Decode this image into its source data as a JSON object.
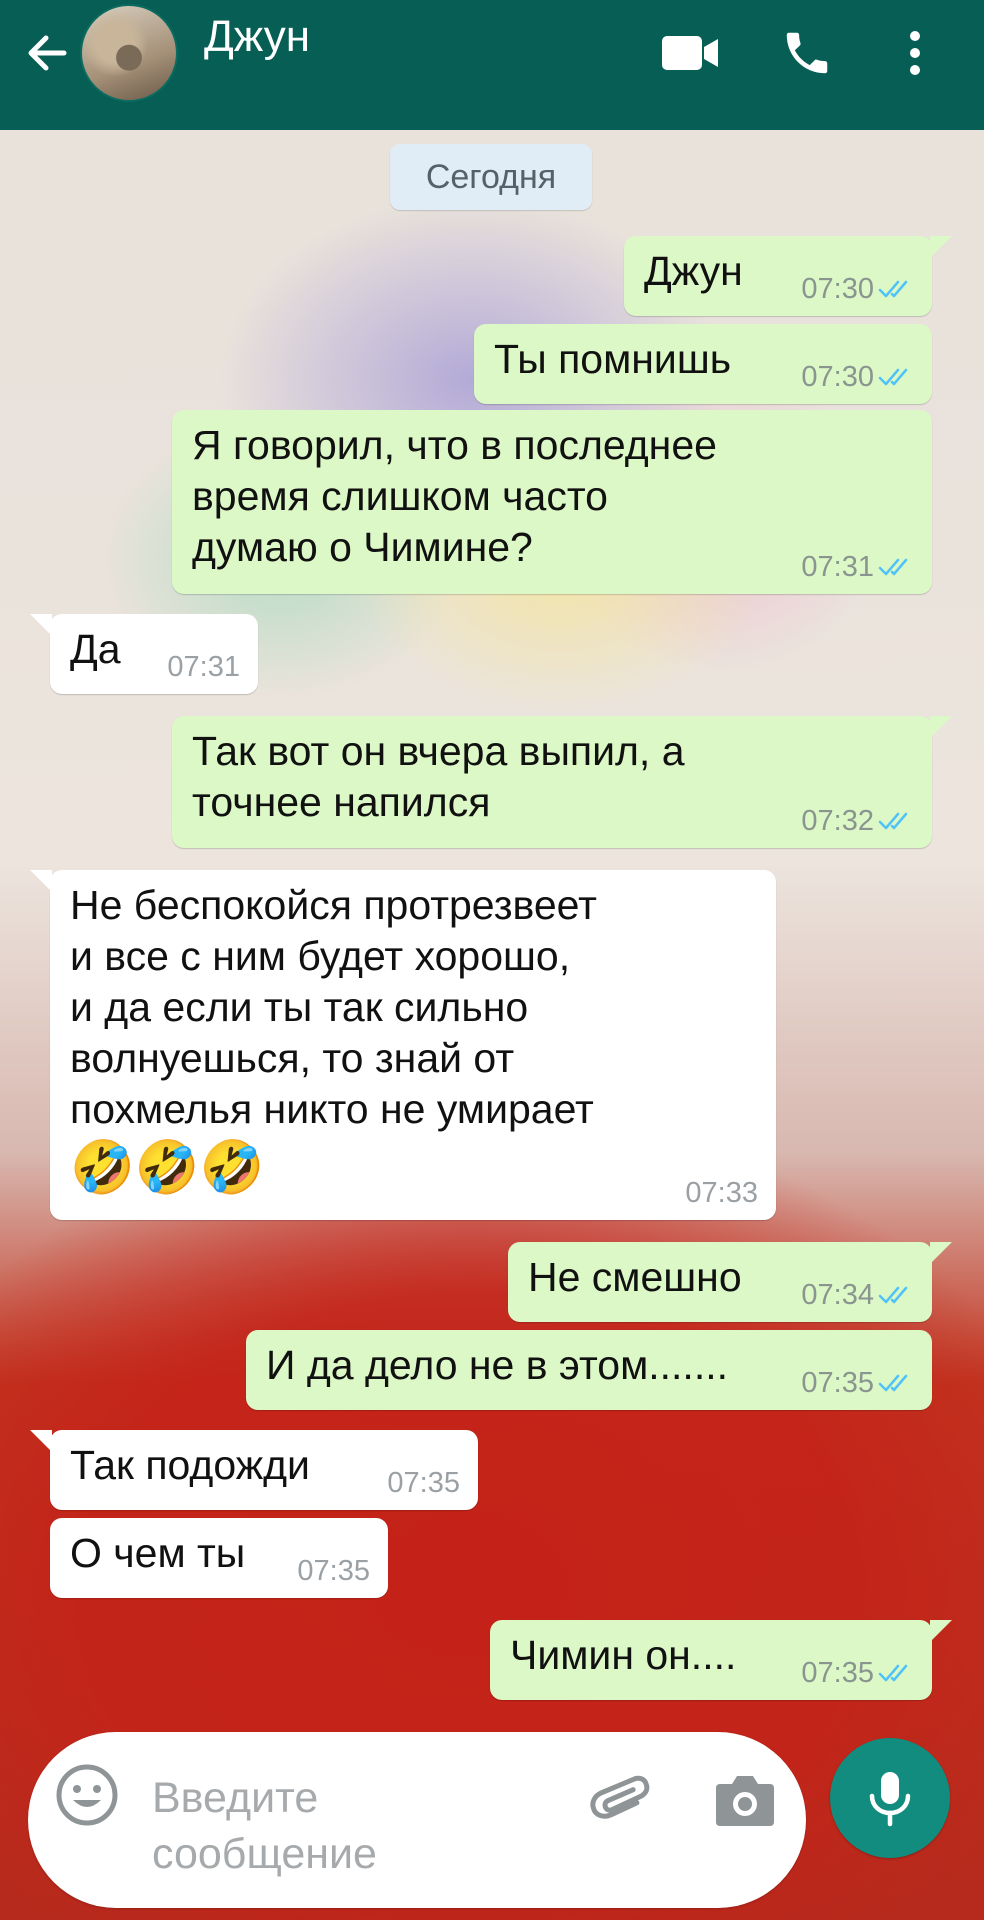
{
  "colors": {
    "header": "#075e54",
    "outgoing_bubble": "#dcf8c6",
    "incoming_bubble": "#ffffff",
    "read_ticks": "#4fc3f7",
    "mic_button": "#128c7e"
  },
  "header": {
    "contact_name": "Джун",
    "icons": [
      "back-arrow-icon",
      "video-call-icon",
      "phone-call-icon",
      "more-vert-icon"
    ]
  },
  "date_divider": "Сегодня",
  "messages": [
    {
      "dir": "out",
      "lines": [
        "Джун"
      ],
      "time": "07:30",
      "status": "read"
    },
    {
      "dir": "out",
      "lines": [
        "Ты помнишь"
      ],
      "time": "07:30",
      "status": "read"
    },
    {
      "dir": "out",
      "lines": [
        "Я говорил, что в последнее",
        "время слишком часто",
        "думаю о Чимине?"
      ],
      "time": "07:31",
      "status": "read"
    },
    {
      "dir": "in",
      "lines": [
        "Да"
      ],
      "time": "07:31"
    },
    {
      "dir": "out",
      "lines": [
        "Так вот он вчера выпил, а",
        "точнее напился"
      ],
      "time": "07:32",
      "status": "read"
    },
    {
      "dir": "in",
      "lines": [
        "Не беспокойся протрезвеет",
        "и все с ним будет хорошо,",
        "и да если ты так сильно",
        "волнуешься, то знай от",
        "похмелья никто не умирает"
      ],
      "emoji": "🤣🤣🤣",
      "time": "07:33"
    },
    {
      "dir": "out",
      "lines": [
        "Не смешно"
      ],
      "time": "07:34",
      "status": "read"
    },
    {
      "dir": "out",
      "lines": [
        "И да дело не в этом......."
      ],
      "time": "07:35",
      "status": "read"
    },
    {
      "dir": "in",
      "lines": [
        "Так подожди"
      ],
      "time": "07:35"
    },
    {
      "dir": "in",
      "lines": [
        "О чем ты"
      ],
      "time": "07:35"
    },
    {
      "dir": "out",
      "lines": [
        "Чимин он...."
      ],
      "time": "07:35",
      "status": "read"
    }
  ],
  "input": {
    "placeholder_line1": "Введите",
    "placeholder_line2": "сообщение",
    "icons": [
      "emoji-icon",
      "attach-icon",
      "camera-icon",
      "mic-icon"
    ]
  }
}
